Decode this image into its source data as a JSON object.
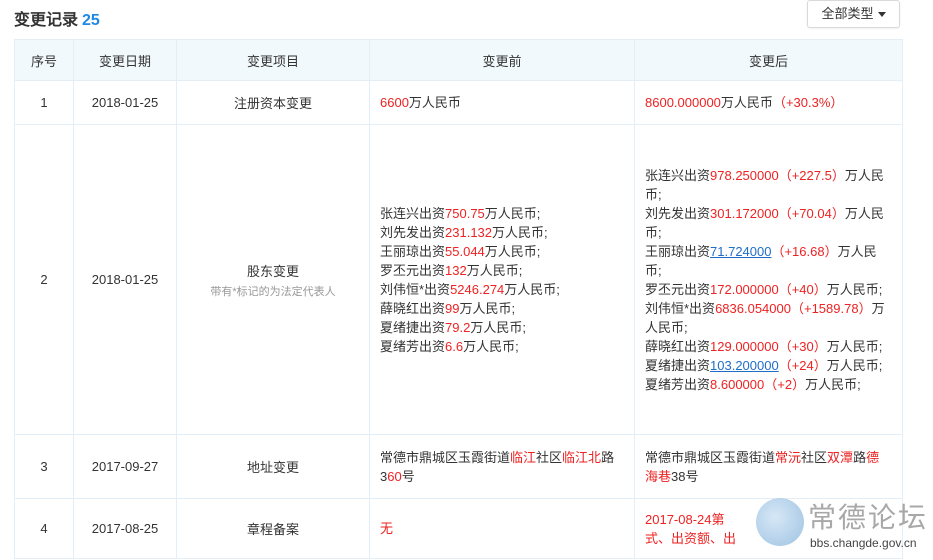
{
  "header": {
    "title": "变更记录",
    "count": "25"
  },
  "filter": {
    "label": "全部类型"
  },
  "columns": [
    "序号",
    "变更日期",
    "变更项目",
    "变更前",
    "变更后"
  ],
  "rows": [
    {
      "no": "1",
      "date": "2018-01-25",
      "item": "注册资本变更",
      "item_note": "",
      "before": [
        [
          {
            "t": "6600",
            "c": "red"
          },
          {
            "t": "万人民币"
          }
        ]
      ],
      "after": [
        [
          {
            "t": "8600.000000",
            "c": "red"
          },
          {
            "t": "万人民币"
          },
          {
            "t": "（+30.3%）",
            "c": "red"
          }
        ]
      ]
    },
    {
      "no": "2",
      "date": "2018-01-25",
      "item": "股东变更",
      "item_note": "带有*标记的为法定代表人",
      "before": [
        [
          {
            "t": "张连兴出资"
          },
          {
            "t": "750.75",
            "c": "red"
          },
          {
            "t": "万人民币;"
          }
        ],
        [
          {
            "t": "刘先发出资"
          },
          {
            "t": "231.132",
            "c": "red"
          },
          {
            "t": "万人民币;"
          }
        ],
        [
          {
            "t": "王丽琼出资"
          },
          {
            "t": "55.044",
            "c": "red"
          },
          {
            "t": "万人民币;"
          }
        ],
        [
          {
            "t": "罗丕元出资"
          },
          {
            "t": "132",
            "c": "red"
          },
          {
            "t": "万人民币;"
          }
        ],
        [
          {
            "t": "刘伟恒*出资"
          },
          {
            "t": "5246.274",
            "c": "red"
          },
          {
            "t": "万人民币;"
          }
        ],
        [
          {
            "t": "薛晓红出资"
          },
          {
            "t": "99",
            "c": "red"
          },
          {
            "t": "万人民币;"
          }
        ],
        [
          {
            "t": "夏绪捷出资"
          },
          {
            "t": "79.2",
            "c": "red"
          },
          {
            "t": "万人民币;"
          }
        ],
        [
          {
            "t": "夏绪芳出资"
          },
          {
            "t": "6.6",
            "c": "red"
          },
          {
            "t": "万人民币;"
          }
        ]
      ],
      "after": [
        [
          {
            "t": "张连兴出资"
          },
          {
            "t": "978.250000",
            "c": "red"
          },
          {
            "t": "（+227.5）",
            "c": "red"
          },
          {
            "t": "万人民币;"
          }
        ],
        [
          {
            "t": "刘先发出资"
          },
          {
            "t": "301.172000",
            "c": "red"
          },
          {
            "t": "（+70.04）",
            "c": "red"
          },
          {
            "t": "万人民币;"
          }
        ],
        [
          {
            "t": "王丽琼出资"
          },
          {
            "t": "71.724000",
            "c": "link"
          },
          {
            "t": "（+16.68）",
            "c": "red"
          },
          {
            "t": "万人民币;"
          }
        ],
        [
          {
            "t": "罗丕元出资"
          },
          {
            "t": "172.000000",
            "c": "red"
          },
          {
            "t": "（+40）",
            "c": "red"
          },
          {
            "t": "万人民币;"
          }
        ],
        [
          {
            "t": "刘伟恒*出资"
          },
          {
            "t": "6836.054000",
            "c": "red"
          },
          {
            "t": "（+1589.78）",
            "c": "red"
          },
          {
            "t": "万人民币;"
          }
        ],
        [
          {
            "t": "薛晓红出资"
          },
          {
            "t": "129.000000",
            "c": "red"
          },
          {
            "t": "（+30）",
            "c": "red"
          },
          {
            "t": "万人民币;"
          }
        ],
        [
          {
            "t": "夏绪捷出资"
          },
          {
            "t": "103.200000",
            "c": "link"
          },
          {
            "t": "（+24）",
            "c": "red"
          },
          {
            "t": "万人民币;"
          }
        ],
        [
          {
            "t": "夏绪芳出资"
          },
          {
            "t": "8.600000",
            "c": "red"
          },
          {
            "t": "（+2）",
            "c": "red"
          },
          {
            "t": "万人民币;"
          }
        ]
      ]
    },
    {
      "no": "3",
      "date": "2017-09-27",
      "item": "地址变更",
      "item_note": "",
      "before": [
        [
          {
            "t": "常德市鼎城区玉霞街道"
          },
          {
            "t": "临江",
            "c": "red"
          },
          {
            "t": "社区"
          },
          {
            "t": "临江北",
            "c": "red"
          },
          {
            "t": "路3"
          },
          {
            "t": "60",
            "c": "red"
          },
          {
            "t": "号"
          }
        ]
      ],
      "after": [
        [
          {
            "t": "常德市鼎城区玉霞街道"
          },
          {
            "t": "常沅",
            "c": "red"
          },
          {
            "t": "社区"
          },
          {
            "t": "双潭",
            "c": "red"
          },
          {
            "t": "路"
          },
          {
            "t": "德海巷",
            "c": "red"
          },
          {
            "t": "38号"
          }
        ]
      ]
    },
    {
      "no": "4",
      "date": "2017-08-25",
      "item": "章程备案",
      "item_note": "",
      "before": [
        [
          {
            "t": "无",
            "c": "red"
          }
        ]
      ],
      "after": [
        [
          {
            "t": "2017-08-24第",
            "c": "red"
          }
        ],
        [
          {
            "t": "式、出资额、出",
            "c": "red"
          }
        ]
      ]
    }
  ],
  "watermark": {
    "title": "常德论坛",
    "url": "bbs.changde.gov.cn"
  }
}
